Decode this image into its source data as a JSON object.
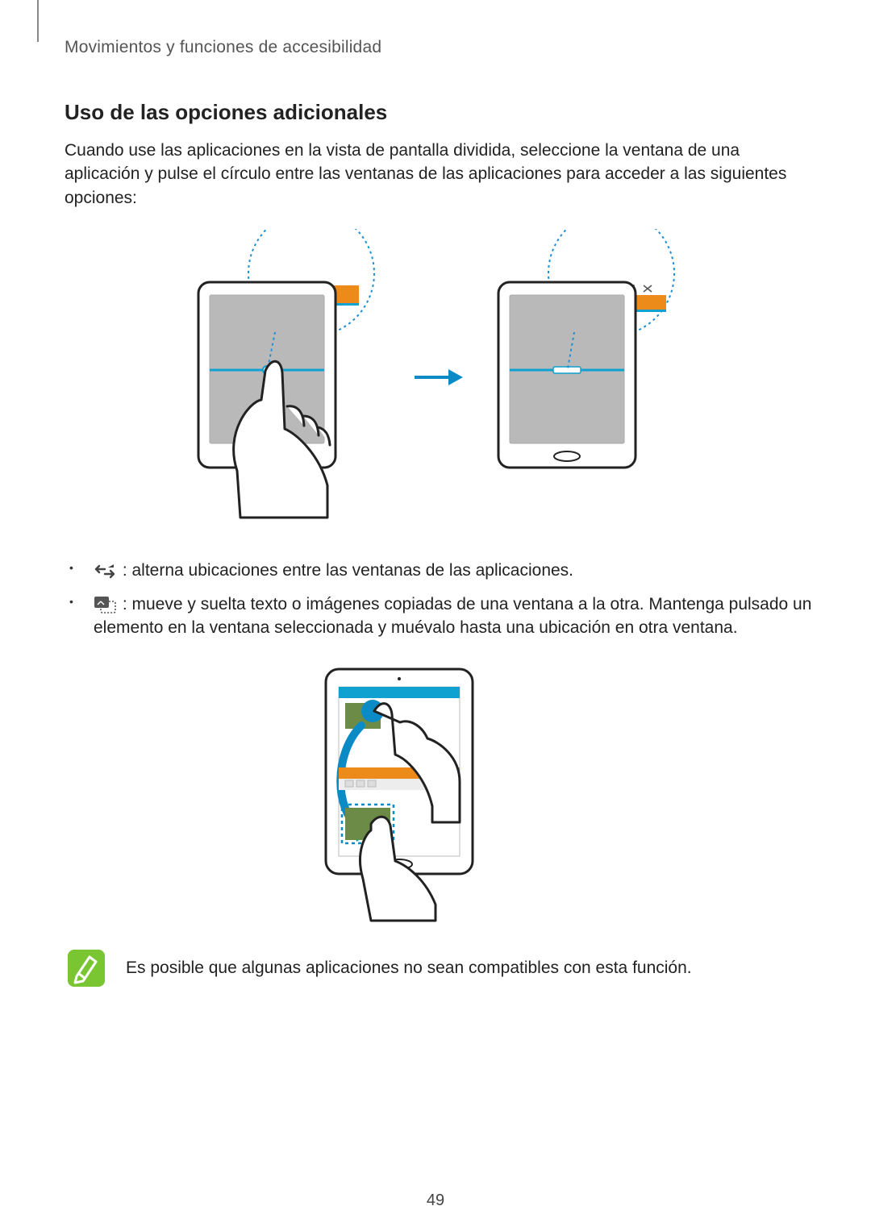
{
  "header": {
    "breadcrumb": "Movimientos y funciones de accesibilidad"
  },
  "section": {
    "title": "Uso de las opciones adicionales",
    "intro": "Cuando use las aplicaciones en la vista de pantalla dividida, seleccione la ventana de una aplicación y pulse el círculo entre las ventanas de las aplicaciones para acceder a las siguientes opciones:"
  },
  "bullets": {
    "items": [
      {
        "icon": "swap-icon",
        "text": " : alterna ubicaciones entre las ventanas de las aplicaciones."
      },
      {
        "icon": "drag-drop-icon",
        "text": " : mueve y suelta texto o imágenes copiadas de una ventana a la otra. Mantenga pulsado un elemento en la ventana seleccionada y muévalo hasta una ubicación en otra ventana."
      }
    ]
  },
  "note": {
    "text": "Es posible que algunas aplicaciones no sean compatibles con esta función."
  },
  "pageNumber": "49"
}
